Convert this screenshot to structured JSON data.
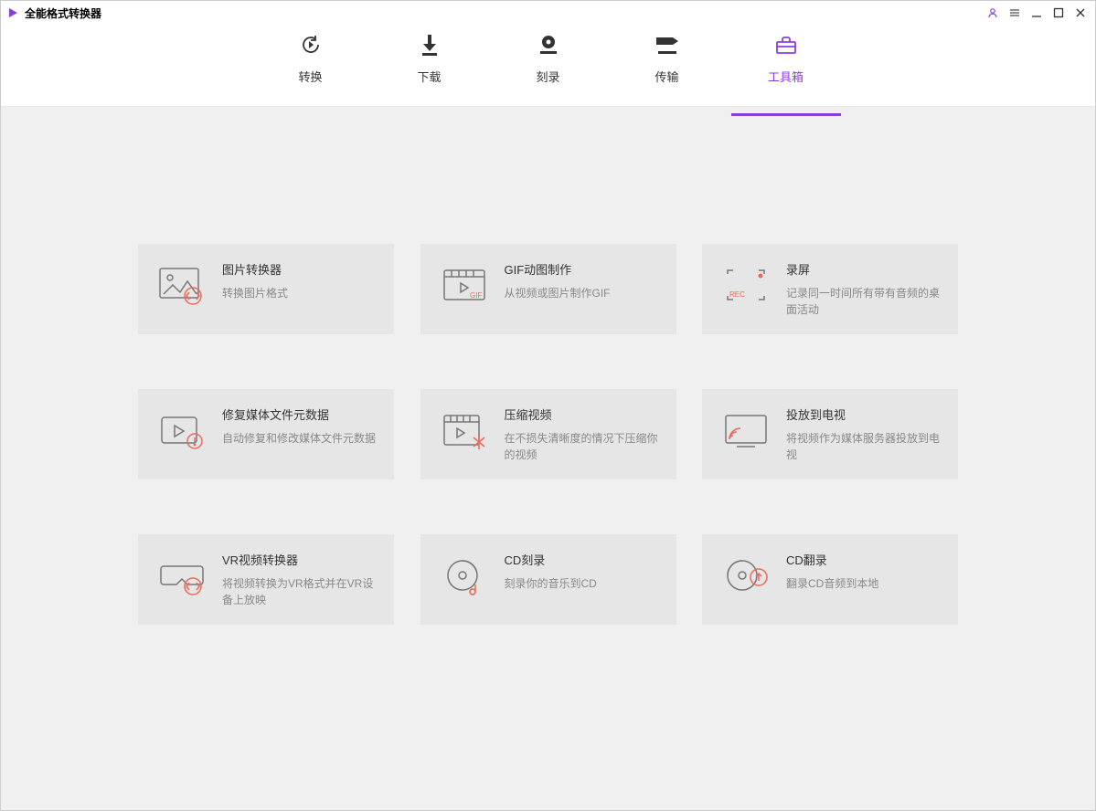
{
  "app": {
    "title": "全能格式转换器"
  },
  "nav": {
    "items": [
      {
        "label": "转换"
      },
      {
        "label": "下载"
      },
      {
        "label": "刻录"
      },
      {
        "label": "传输"
      },
      {
        "label": "工具箱"
      }
    ]
  },
  "tools": [
    {
      "title": "图片转换器",
      "desc": "转换图片格式"
    },
    {
      "title": "GIF动图制作",
      "desc": "从视频或图片制作GIF"
    },
    {
      "title": "录屏",
      "desc": "记录同一时间所有带有音频的桌面活动"
    },
    {
      "title": "修复媒体文件元数据",
      "desc": "自动修复和修改媒体文件元数据"
    },
    {
      "title": "压缩视频",
      "desc": "在不损失清晰度的情况下压缩你的视频"
    },
    {
      "title": "投放到电视",
      "desc": "将视频作为媒体服务器投放到电视"
    },
    {
      "title": "VR视频转换器",
      "desc": "将视频转换为VR格式并在VR设备上放映"
    },
    {
      "title": "CD刻录",
      "desc": "刻录你的音乐到CD"
    },
    {
      "title": "CD翻录",
      "desc": "翻录CD音频到本地"
    }
  ]
}
